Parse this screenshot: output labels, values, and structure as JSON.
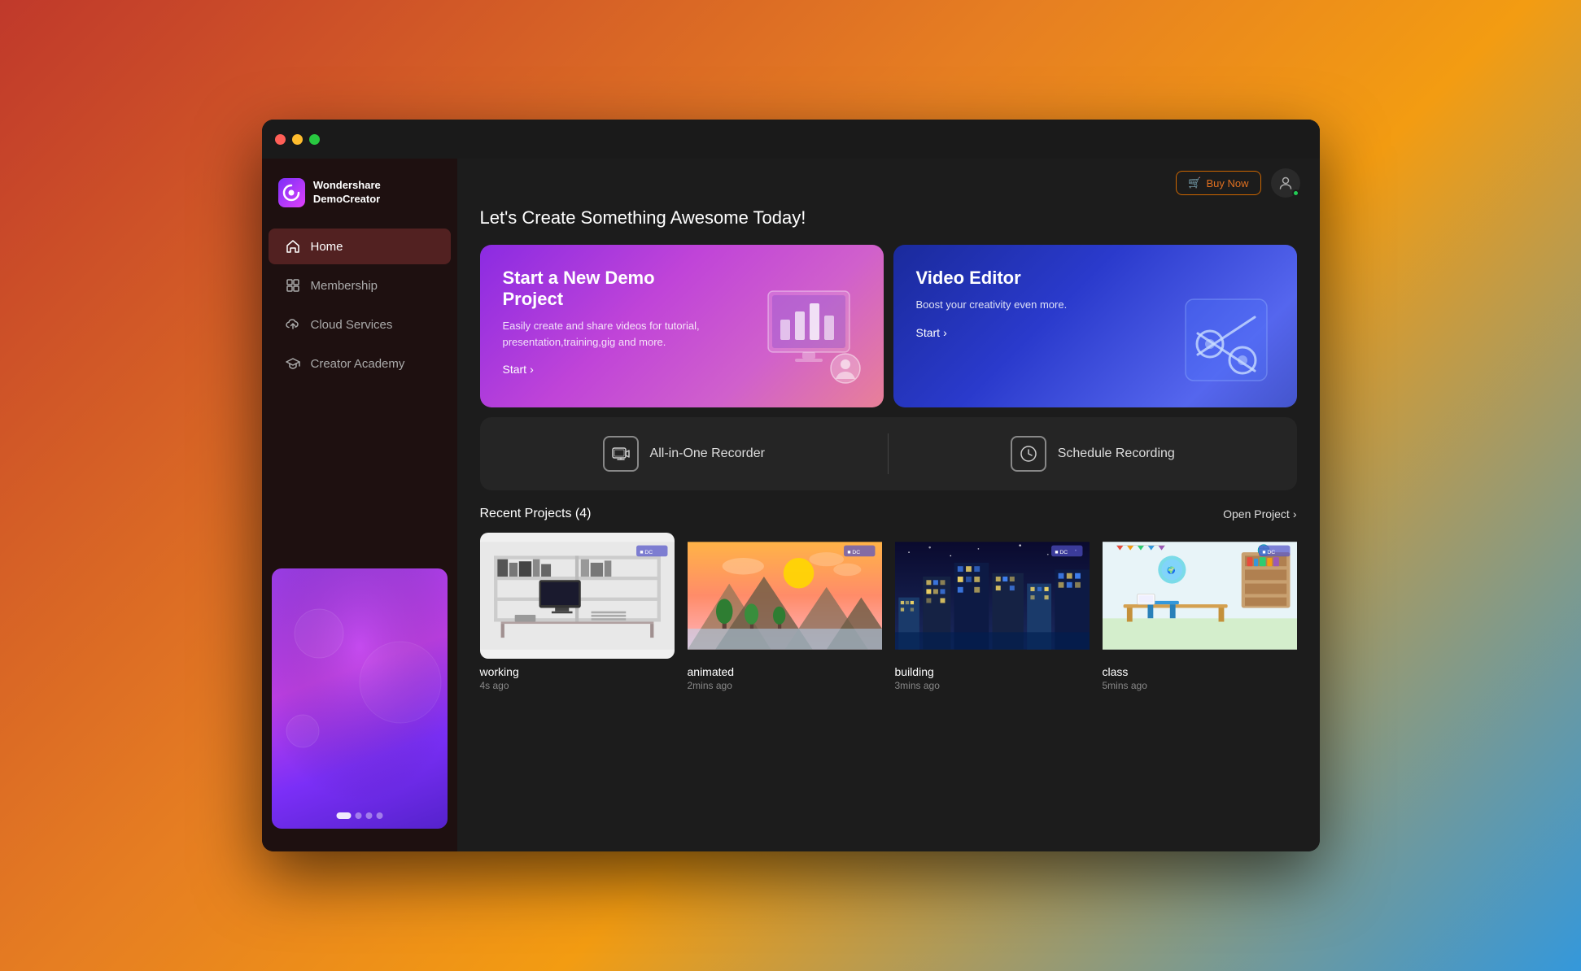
{
  "window": {
    "title": "Wondershare DemoCreator"
  },
  "sidebar": {
    "brand_name": "Wondershare\nDemoCreator",
    "nav_items": [
      {
        "id": "home",
        "label": "Home",
        "icon": "⌂",
        "active": true
      },
      {
        "id": "membership",
        "label": "Membership",
        "icon": "⊞"
      },
      {
        "id": "cloud",
        "label": "Cloud Services",
        "icon": "↑"
      },
      {
        "id": "academy",
        "label": "Creator Academy",
        "icon": "🎓"
      }
    ]
  },
  "topbar": {
    "buy_now": "Buy Now",
    "cart_icon": "🛒"
  },
  "main": {
    "greeting": "Let's Create Something Awesome Today!",
    "hero_cards": [
      {
        "id": "demo",
        "title": "Start a New Demo Project",
        "desc": "Easily create and share videos for tutorial, presentation,training,gig and more.",
        "start_label": "Start"
      },
      {
        "id": "editor",
        "title": "Video Editor",
        "desc": "Boost your creativity even more.",
        "start_label": "Start"
      }
    ],
    "recorder_section": {
      "all_in_one_label": "All-in-One Recorder",
      "schedule_label": "Schedule Recording"
    },
    "recent_projects": {
      "title": "Recent Projects (4)",
      "open_project_label": "Open Project",
      "items": [
        {
          "name": "working",
          "time": "4s ago",
          "thumb": "working"
        },
        {
          "name": "animated",
          "time": "2mins ago",
          "thumb": "animated"
        },
        {
          "name": "building",
          "time": "3mins ago",
          "thumb": "building"
        },
        {
          "name": "class",
          "time": "5mins ago",
          "thumb": "class"
        }
      ]
    }
  }
}
